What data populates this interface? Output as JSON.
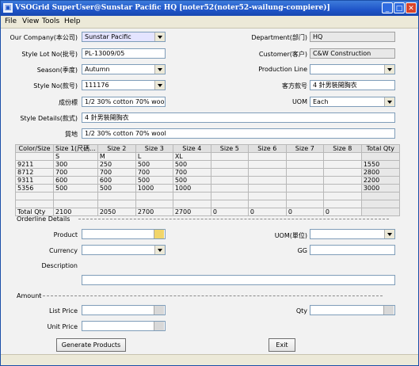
{
  "window": {
    "title": "VSOGrid  SuperUser@Sunstar Pacific HQ [noter52(noter52-wailung-compiere)]",
    "icon": "app-icon"
  },
  "menu": [
    "File",
    "View",
    "Tools",
    "Help"
  ],
  "header": {
    "company_label": "Our Company(本公司)",
    "company_value": "Sunstar Pacific",
    "department_label": "Department(部门)",
    "department_value": "HQ",
    "style_lot_label": "Style Lot No(批号)",
    "style_lot_value": "PL-13009/05",
    "customer_label": "Customer(客户)",
    "customer_value": "C&W Construction",
    "season_label": "Season(季度)",
    "season_value": "Autumn",
    "production_line_label": "Production Line",
    "production_line_value": "",
    "style_no_label": "Style No(款号)",
    "style_no_value": "111176",
    "cust_style_label": "客方款号",
    "cust_style_value": "4 針男裝開胸衣",
    "composition_label": "成份標",
    "composition_value": "1/2 30% cotton 70% wool",
    "uom_label": "UOM",
    "uom_value": "Each",
    "style_details_label": "Style Details(款式)",
    "style_details_value": "4 針男裝開胸衣",
    "material_label": "質地",
    "material_value": "1/2 30% cotton 70% wool"
  },
  "grid": {
    "columns": [
      "Color/Size",
      "Size 1(尺碼...",
      "Size 2",
      "Size 3",
      "Size 4",
      "Size 5",
      "Size 6",
      "Size 7",
      "Size 8",
      "Total Qty"
    ],
    "size_row": [
      "",
      "S",
      "M",
      "L",
      "XL",
      "",
      "",
      "",
      "",
      ""
    ],
    "rows": [
      [
        "9211",
        "300",
        "250",
        "500",
        "500",
        "",
        "",
        "",
        "",
        "1550"
      ],
      [
        "8712",
        "700",
        "700",
        "700",
        "700",
        "",
        "",
        "",
        "",
        "2800"
      ],
      [
        "9311",
        "600",
        "600",
        "500",
        "500",
        "",
        "",
        "",
        "",
        "2200"
      ],
      [
        "5356",
        "500",
        "500",
        "1000",
        "1000",
        "",
        "",
        "",
        "",
        "3000"
      ]
    ],
    "total_row": [
      "Total Qty",
      "2100",
      "2050",
      "2700",
      "2700",
      "0",
      "0",
      "0",
      "0",
      ""
    ]
  },
  "orderline": {
    "section_label": "Orderline Details",
    "product_label": "Product",
    "product_value": "",
    "uom_label": "UOM(單位)",
    "uom_value": "",
    "currency_label": "Currency",
    "currency_value": "",
    "gg_label": "GG",
    "gg_value": "",
    "description_label": "Description",
    "description_value": ""
  },
  "amount": {
    "section_label": "Amount",
    "list_price_label": "List Price",
    "list_price_value": "",
    "qty_label": "Qty",
    "qty_value": "",
    "unit_price_label": "Unit Price",
    "unit_price_value": ""
  },
  "buttons": {
    "generate": "Generate Products",
    "exit": "Exit"
  }
}
